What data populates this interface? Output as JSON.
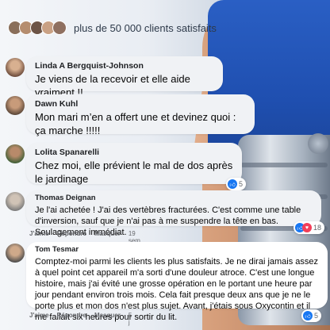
{
  "header": {
    "text": "plus de 50 000 clients satisfaits"
  },
  "comments": [
    {
      "name": "Linda A Bergquist-Johnson",
      "text": "Je viens de la recevoir et elle aide vraiment !!"
    },
    {
      "name": "Dawn Kuhl",
      "text": "Mon mari m’en a offert une et devinez quoi : ça marche !!!!!"
    },
    {
      "name": "Lolita Spanarelli",
      "text": "Chez moi, elle prévient le mal de dos après le jardinage",
      "reaction_count": "5"
    },
    {
      "name": "Thomas Deignan",
      "text": "Je l'ai achetée ! J'ai des vertèbres fracturées. C'est comme une table d'inversion, sauf que je n'ai pas à me suspendre la tête en bas. Soulagement immédiat.",
      "like": "J'aime",
      "reply": "Répondre",
      "hide": "Masquer",
      "time": "19 sem.",
      "reaction_count": "18"
    },
    {
      "name": "Tom Tesmar",
      "text": "Comptez-moi parmi les clients les plus satisfaits. Je ne dirai jamais assez à quel point cet appareil m'a sorti d'une douleur atroce. C'est une longue histoire, mais j'ai évité une grosse opération en le portant une heure par jour pendant environ trois mois. Cela fait presque deux ans que je ne le porte plus et mon dos n'est plus sujet. Avant, j'étais sous Oxycontin et il me fallait six heures pour sortir du lit.",
      "like": "J'aime",
      "reply": "Répondre",
      "hide": "Masquer",
      "time": "5 j",
      "reaction_count": "5"
    }
  ],
  "colors": {
    "like_blue": "#1877f2",
    "love_red": "#f33e58",
    "shirt_blue": "#2a5fc4"
  },
  "icons": [
    "like-icon",
    "love-icon"
  ]
}
